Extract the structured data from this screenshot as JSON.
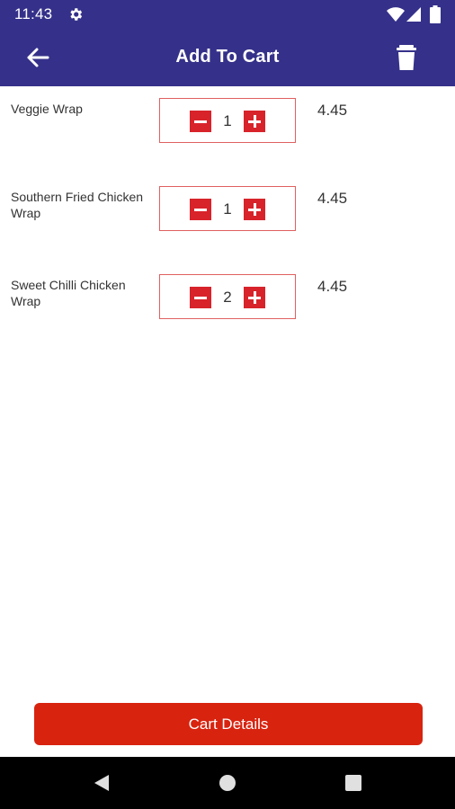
{
  "status_bar": {
    "time": "11:43",
    "icons": [
      "gear-icon",
      "wifi-icon",
      "signal-icon",
      "battery-icon"
    ]
  },
  "app_bar": {
    "title": "Add To Cart",
    "back_icon": "arrow-left-icon",
    "delete_icon": "trash-icon",
    "background": "#35318a"
  },
  "cart": {
    "items": [
      {
        "name": "Veggie Wrap",
        "quantity": "1",
        "price": "4.45"
      },
      {
        "name": "Southern Fried Chicken Wrap",
        "quantity": "1",
        "price": "4.45"
      },
      {
        "name": "Sweet Chilli Chicken Wrap",
        "quantity": "2",
        "price": "4.45"
      }
    ],
    "stepper_color": "#d8232a"
  },
  "footer": {
    "cart_details_label": "Cart Details",
    "button_color": "#d8230f"
  },
  "nav_bar": {
    "icons": [
      "nav-back-icon",
      "nav-home-icon",
      "nav-recent-icon"
    ]
  }
}
